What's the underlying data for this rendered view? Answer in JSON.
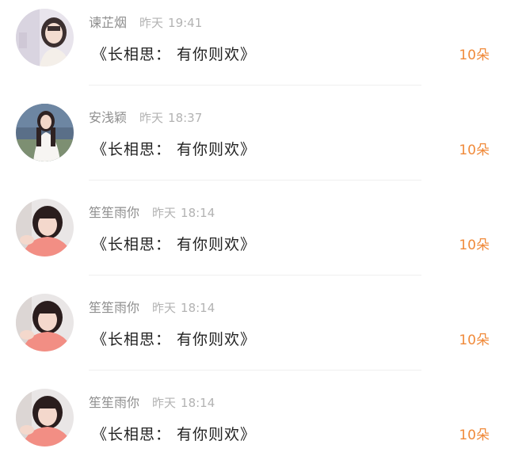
{
  "comments": [
    {
      "username": "谏芷烟",
      "date": "昨天",
      "time": "19:41",
      "message": "《长相思： 有你则欢》",
      "gift": "10朵",
      "avatar_icon": "girl-light-photo-avatar"
    },
    {
      "username": "安浅颖",
      "date": "昨天",
      "time": "18:37",
      "message": "《长相思： 有你则欢》",
      "gift": "10朵",
      "avatar_icon": "girl-white-dress-avatar"
    },
    {
      "username": "笙笙雨你",
      "date": "昨天",
      "time": "18:14",
      "message": "《长相思： 有你则欢》",
      "gift": "10朵",
      "avatar_icon": "girl-pink-top-avatar"
    },
    {
      "username": "笙笙雨你",
      "date": "昨天",
      "time": "18:14",
      "message": "《长相思： 有你则欢》",
      "gift": "10朵",
      "avatar_icon": "girl-pink-top-avatar"
    },
    {
      "username": "笙笙雨你",
      "date": "昨天",
      "time": "18:14",
      "message": "《长相思： 有你则欢》",
      "gift": "10朵",
      "avatar_icon": "girl-pink-top-avatar"
    }
  ],
  "colors": {
    "gift_accent": "#f08a3a",
    "username": "#8e8e8e",
    "timestamp": "#b3b3b3",
    "message": "#222222",
    "divider": "#efefef"
  }
}
